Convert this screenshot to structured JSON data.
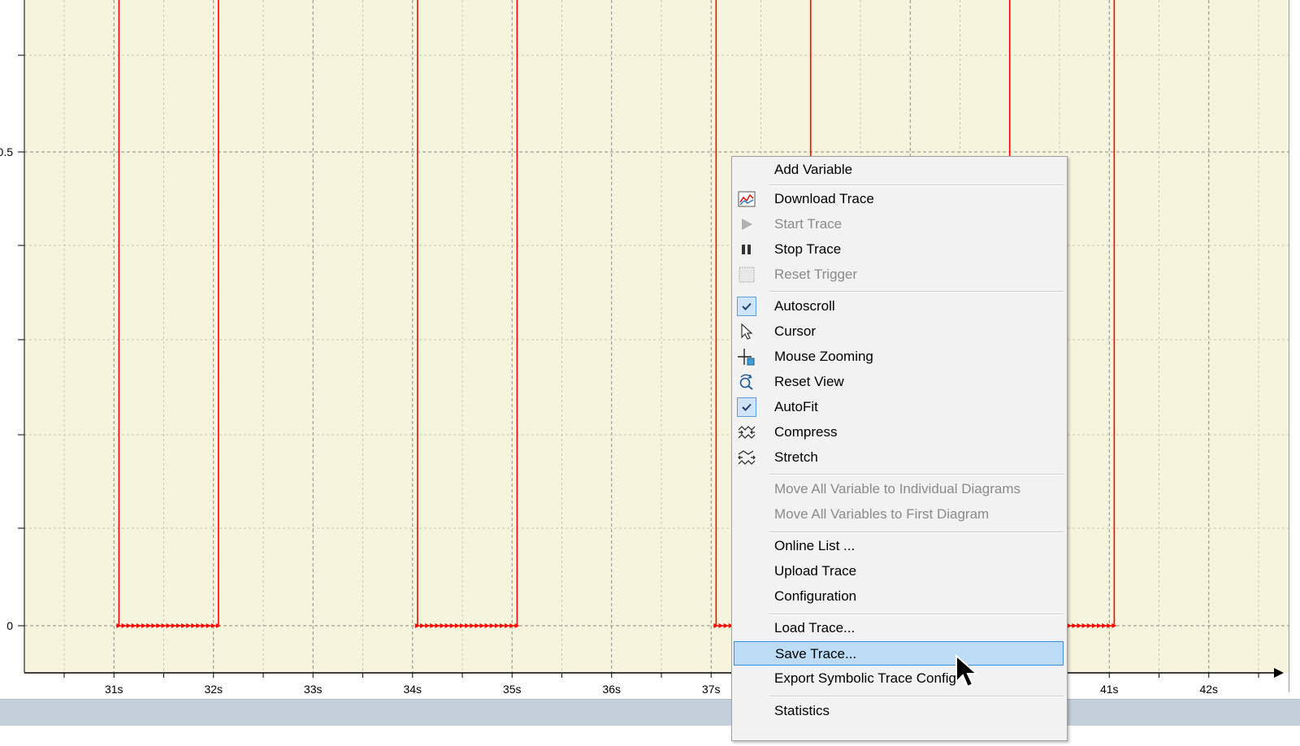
{
  "chart_data": {
    "type": "line",
    "y_ticks": [
      "0.5",
      "0"
    ],
    "x_ticks": [
      "31s",
      "32s",
      "33s",
      "34s",
      "35s",
      "36s",
      "37s",
      "41s",
      "42s"
    ],
    "xlim": [
      30.1,
      42.7
    ],
    "ylim": [
      -0.05,
      0.66
    ],
    "grid": true,
    "series": [
      {
        "color": "#ff0000",
        "values": [
          [
            30.1,
            1
          ],
          [
            31.05,
            1
          ],
          [
            31.05,
            0
          ],
          [
            32.05,
            0
          ],
          [
            32.05,
            1
          ],
          [
            34.05,
            1
          ],
          [
            34.05,
            0
          ],
          [
            35.05,
            0
          ],
          [
            35.05,
            1
          ],
          [
            37.05,
            1
          ],
          [
            37.05,
            0
          ],
          [
            37.2,
            0
          ],
          [
            38.0,
            0
          ],
          [
            38.0,
            1
          ],
          [
            40.0,
            1
          ],
          [
            40.0,
            0
          ],
          [
            41.05,
            0
          ],
          [
            41.05,
            1
          ],
          [
            42.7,
            1
          ]
        ]
      }
    ]
  },
  "context_menu": {
    "items": [
      {
        "label": "Add Variable",
        "icon": "",
        "disabled": false
      },
      {
        "separator": true
      },
      {
        "label": "Download Trace",
        "icon": "download-trace-icon",
        "disabled": false
      },
      {
        "label": "Start Trace",
        "icon": "play-icon",
        "disabled": true
      },
      {
        "label": "Stop Trace",
        "icon": "pause-icon",
        "disabled": false
      },
      {
        "label": "Reset Trigger",
        "icon": "reset-trigger-icon",
        "disabled": true
      },
      {
        "separator": true
      },
      {
        "label": "Autoscroll",
        "icon": "check-icon",
        "checked": true,
        "disabled": false
      },
      {
        "label": "Cursor",
        "icon": "cursor-arrow-icon",
        "disabled": false
      },
      {
        "label": "Mouse Zooming",
        "icon": "zoom-crosshair-icon",
        "disabled": false
      },
      {
        "label": "Reset View",
        "icon": "reset-view-icon",
        "disabled": false
      },
      {
        "label": "AutoFit",
        "icon": "check-icon",
        "checked": true,
        "disabled": false
      },
      {
        "label": "Compress",
        "icon": "compress-icon",
        "disabled": false
      },
      {
        "label": "Stretch",
        "icon": "stretch-icon",
        "disabled": false
      },
      {
        "separator": true
      },
      {
        "label": "Move All Variable to Individual Diagrams",
        "icon": "",
        "disabled": true
      },
      {
        "label": "Move All Variables to First Diagram",
        "icon": "",
        "disabled": true
      },
      {
        "separator": true
      },
      {
        "label": "Online List ...",
        "icon": "",
        "disabled": false
      },
      {
        "label": "Upload Trace",
        "icon": "",
        "disabled": false
      },
      {
        "label": "Configuration",
        "icon": "",
        "disabled": false
      },
      {
        "separator": true
      },
      {
        "label": "Load Trace...",
        "icon": "",
        "disabled": false
      },
      {
        "label": "Save Trace...",
        "icon": "",
        "disabled": false,
        "highlighted": true
      },
      {
        "label": "Export Symbolic Trace Config",
        "icon": "",
        "disabled": false
      },
      {
        "separator": true
      },
      {
        "label": "Statistics",
        "icon": "",
        "disabled": false
      }
    ]
  }
}
